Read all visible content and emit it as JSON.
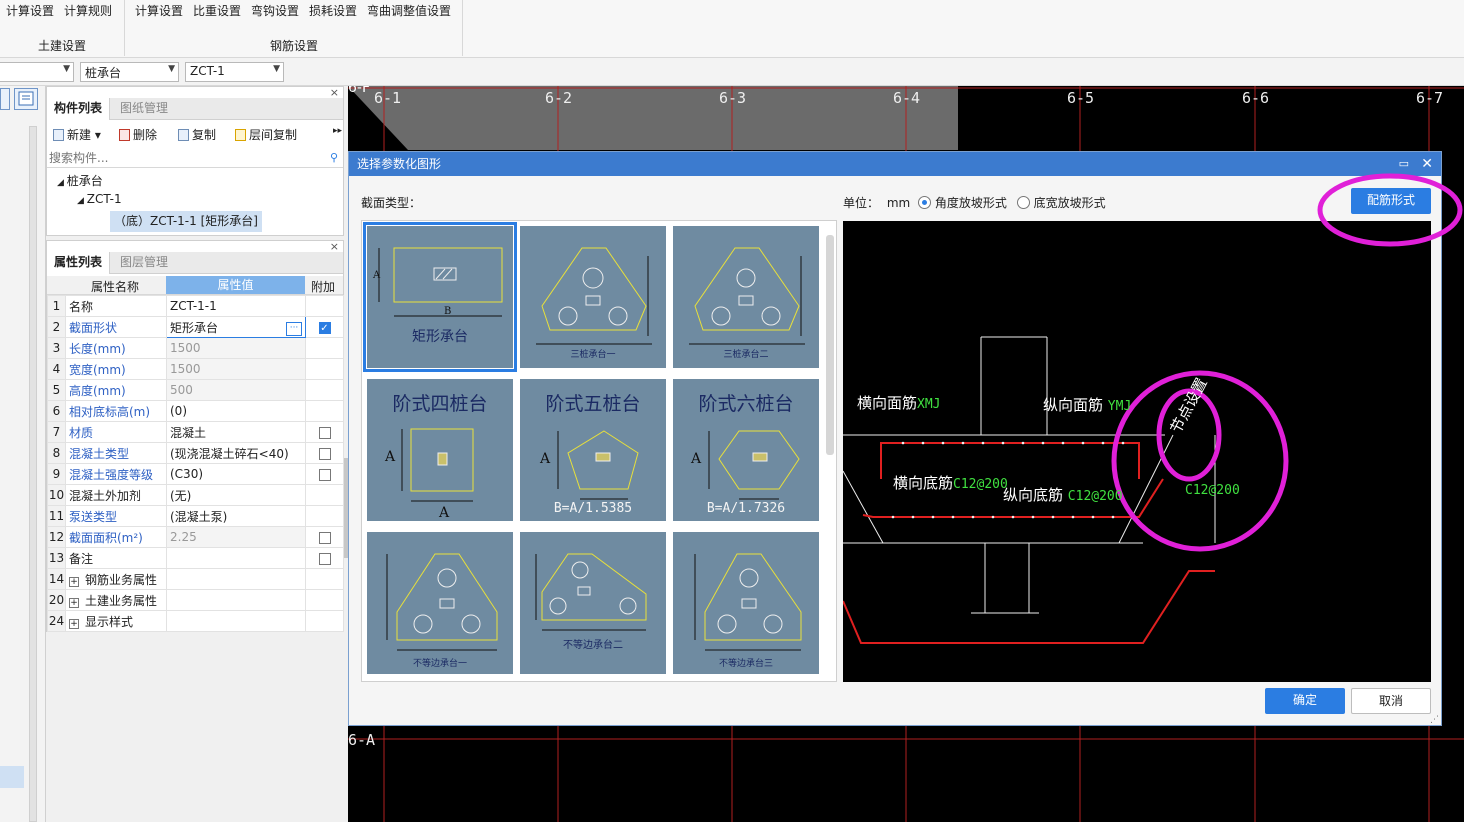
{
  "ribbon": {
    "group1_items": [
      "计算设置",
      "计算规则"
    ],
    "group1_label": "土建设置",
    "group2_items": [
      "计算设置",
      "比重设置",
      "弯钩设置",
      "损耗设置",
      "弯曲调整值设置"
    ],
    "group2_label": "钢筋设置"
  },
  "selectors": {
    "first": "",
    "second": "桩承台",
    "third": "ZCT-1"
  },
  "component_panel": {
    "tabs": [
      "构件列表",
      "图纸管理"
    ],
    "toolbar": {
      "new": "新建",
      "delete": "删除",
      "copy": "复制",
      "floor_copy": "层间复制"
    },
    "search_placeholder": "搜索构件...",
    "tree": {
      "root": "桩承台",
      "child": "ZCT-1",
      "leaf": "（底）ZCT-1-1 [矩形承台]"
    }
  },
  "property_panel": {
    "tabs": [
      "属性列表",
      "图层管理"
    ],
    "headers": [
      "属性名称",
      "属性值",
      "附加"
    ],
    "rows": [
      {
        "no": "1",
        "name": "名称",
        "value": "ZCT-1-1",
        "style": "plain",
        "check": "none"
      },
      {
        "no": "2",
        "name": "截面形状",
        "value": "矩形承台",
        "style": "blue",
        "check": "on"
      },
      {
        "no": "3",
        "name": "长度(mm)",
        "value": "1500",
        "style": "gray",
        "check": "none"
      },
      {
        "no": "4",
        "name": "宽度(mm)",
        "value": "1500",
        "style": "gray",
        "check": "none"
      },
      {
        "no": "5",
        "name": "高度(mm)",
        "value": "500",
        "style": "gray",
        "check": "none"
      },
      {
        "no": "6",
        "name": "相对底标高(m)",
        "value": "(0)",
        "style": "blue",
        "check": "none"
      },
      {
        "no": "7",
        "name": "材质",
        "value": "混凝土",
        "style": "blue",
        "check": "off"
      },
      {
        "no": "8",
        "name": "混凝土类型",
        "value": "(现浇混凝土碎石<40)",
        "style": "blue",
        "check": "off"
      },
      {
        "no": "9",
        "name": "混凝土强度等级",
        "value": "(C30)",
        "style": "blue",
        "check": "off"
      },
      {
        "no": "10",
        "name": "混凝土外加剂",
        "value": "(无)",
        "style": "plain",
        "check": "none"
      },
      {
        "no": "11",
        "name": "泵送类型",
        "value": "(混凝土泵)",
        "style": "blue",
        "check": "none"
      },
      {
        "no": "12",
        "name": "截面面积(m²)",
        "value": "2.25",
        "style": "gray",
        "check": "off"
      },
      {
        "no": "13",
        "name": "备注",
        "value": "",
        "style": "plain",
        "check": "off"
      },
      {
        "no": "14",
        "name": "钢筋业务属性",
        "value": "",
        "style": "group",
        "check": "none"
      },
      {
        "no": "20",
        "name": "土建业务属性",
        "value": "",
        "style": "group",
        "check": "none"
      },
      {
        "no": "24",
        "name": "显示样式",
        "value": "",
        "style": "group",
        "check": "none"
      }
    ]
  },
  "cad": {
    "axes": [
      "6-1",
      "6-2",
      "6-3",
      "6-4",
      "6-5",
      "6-6",
      "6-7"
    ],
    "axis_a": "6-A",
    "corner_label": "6-F"
  },
  "dialog": {
    "title": "选择参数化图形",
    "section_label": "截面类型：",
    "unit_label": "单位：",
    "unit": "mm",
    "radio1": "角度放坡形式",
    "radio2": "底宽放坡形式",
    "rebar_button": "配筋形式",
    "ok": "确定",
    "cancel": "取消",
    "shapes": [
      "矩形承台",
      "三桩承台一",
      "三桩承台二",
      "阶式四桩台",
      "阶式五桩台",
      "阶式六桩台",
      "不等边承台一",
      "不等边承台二",
      "不等边承台三"
    ],
    "shape_notes": [
      "B=A/1.5385",
      "B=A/1.7326"
    ],
    "preview": {
      "label_top_h": "横向面筋",
      "label_top_h_code": "XMJ",
      "label_top_v": "纵向面筋",
      "label_top_v_code": "YMJ",
      "label_bot_h": "横向底筋",
      "label_bot_h_code": "C12@200",
      "label_bot_v": "纵向底筋",
      "label_bot_v_code": "C12@200",
      "label_node": "节点设置",
      "label_right_code": "C12@200"
    }
  },
  "colors": {
    "accent": "#2b7de2",
    "annotation": "#e020d8",
    "cad_red": "#e02020",
    "cad_green": "#40e040"
  }
}
